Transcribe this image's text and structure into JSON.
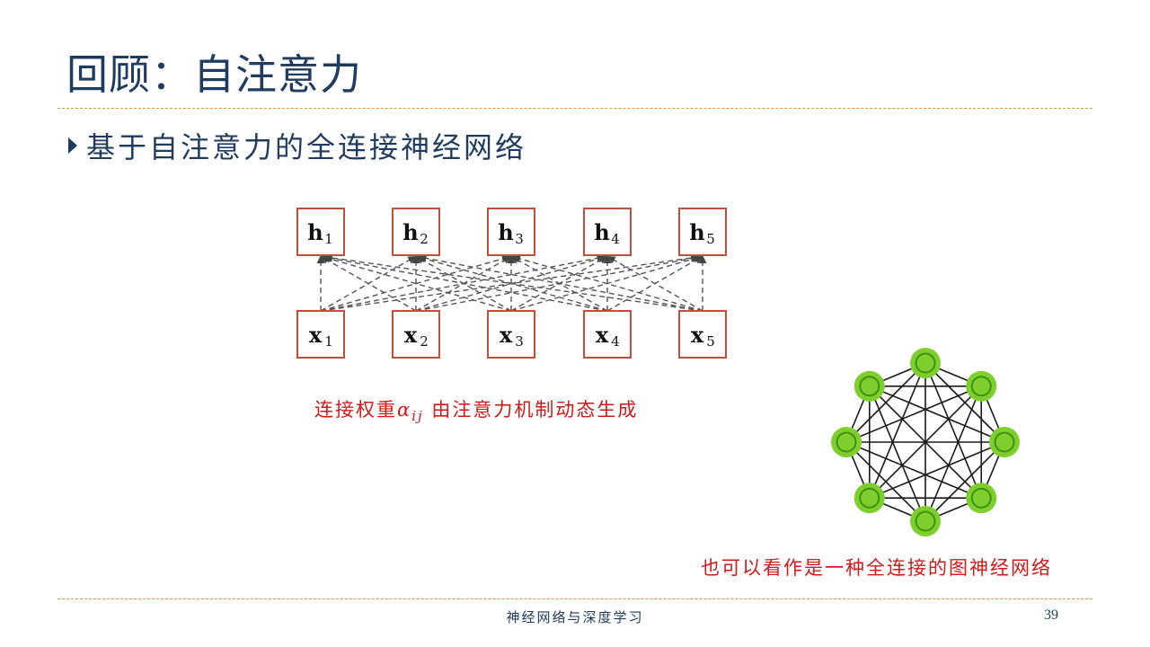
{
  "slide": {
    "title": "回顾：自注意力",
    "bullet": "基于自注意力的全连接神经网络",
    "caption_prefix": "连接权重",
    "caption_alpha": "α",
    "caption_alpha_sub": "ij",
    "caption_suffix": " 由注意力机制动态生成",
    "graph_caption": "也可以看作是一种全连接的图神经网络",
    "footer": "神经网络与深度学习",
    "page_number": "39"
  },
  "diagram": {
    "outputs": [
      {
        "label": "h",
        "sub": "1"
      },
      {
        "label": "h",
        "sub": "2"
      },
      {
        "label": "h",
        "sub": "3"
      },
      {
        "label": "h",
        "sub": "4"
      },
      {
        "label": "h",
        "sub": "5"
      }
    ],
    "inputs": [
      {
        "label": "x",
        "sub": "1"
      },
      {
        "label": "x",
        "sub": "2"
      },
      {
        "label": "x",
        "sub": "3"
      },
      {
        "label": "x",
        "sub": "4"
      },
      {
        "label": "x",
        "sub": "5"
      }
    ],
    "connectivity": "fully-connected",
    "edge_style": "dashed-arrow",
    "box_color": "#c0503e"
  },
  "graph": {
    "node_count": 8,
    "connectivity": "complete",
    "node_color": "#7ccf2c",
    "node_ring_color": "#3f8f12"
  },
  "colors": {
    "title": "#1f3b5e",
    "accent_rule": "#d79a3a",
    "caption_red": "#d0191b"
  }
}
